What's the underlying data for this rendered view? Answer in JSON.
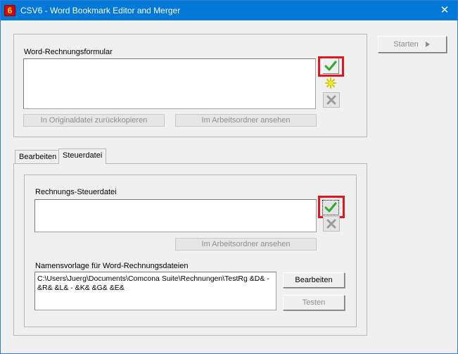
{
  "window": {
    "title": "CSV6 - Word Bookmark Editor and Merger",
    "icon_glyph": "6",
    "close_glyph": "✕"
  },
  "toolbar": {
    "start_label": "Starten"
  },
  "invoice_form": {
    "label": "Word-Rechnungsformular",
    "value": "",
    "copy_back_label": "In Originaldatei zurückkopieren",
    "view_in_workdir_label": "Im Arbeitsordner ansehen"
  },
  "tabs": [
    {
      "label": "Bearbeiten"
    },
    {
      "label": "Steuerdatei"
    }
  ],
  "control_file": {
    "label": "Rechnungs-Steuerdatei",
    "value": "",
    "view_in_workdir_label": "Im Arbeitsordner ansehen"
  },
  "name_template": {
    "label": "Namensvorlage für Word-Rechnungsdateien",
    "value": "C:\\Users\\Juerg\\Documents\\Comcona Suite\\Rechnungen\\TestRg &D& - &R& &L& - &K& &G& &E&",
    "edit_label": "Bearbeiten",
    "test_label": "Testen"
  },
  "colors": {
    "titlebar": "#0078d7",
    "highlight": "#e0171f",
    "check_green": "#2eaa2e"
  }
}
